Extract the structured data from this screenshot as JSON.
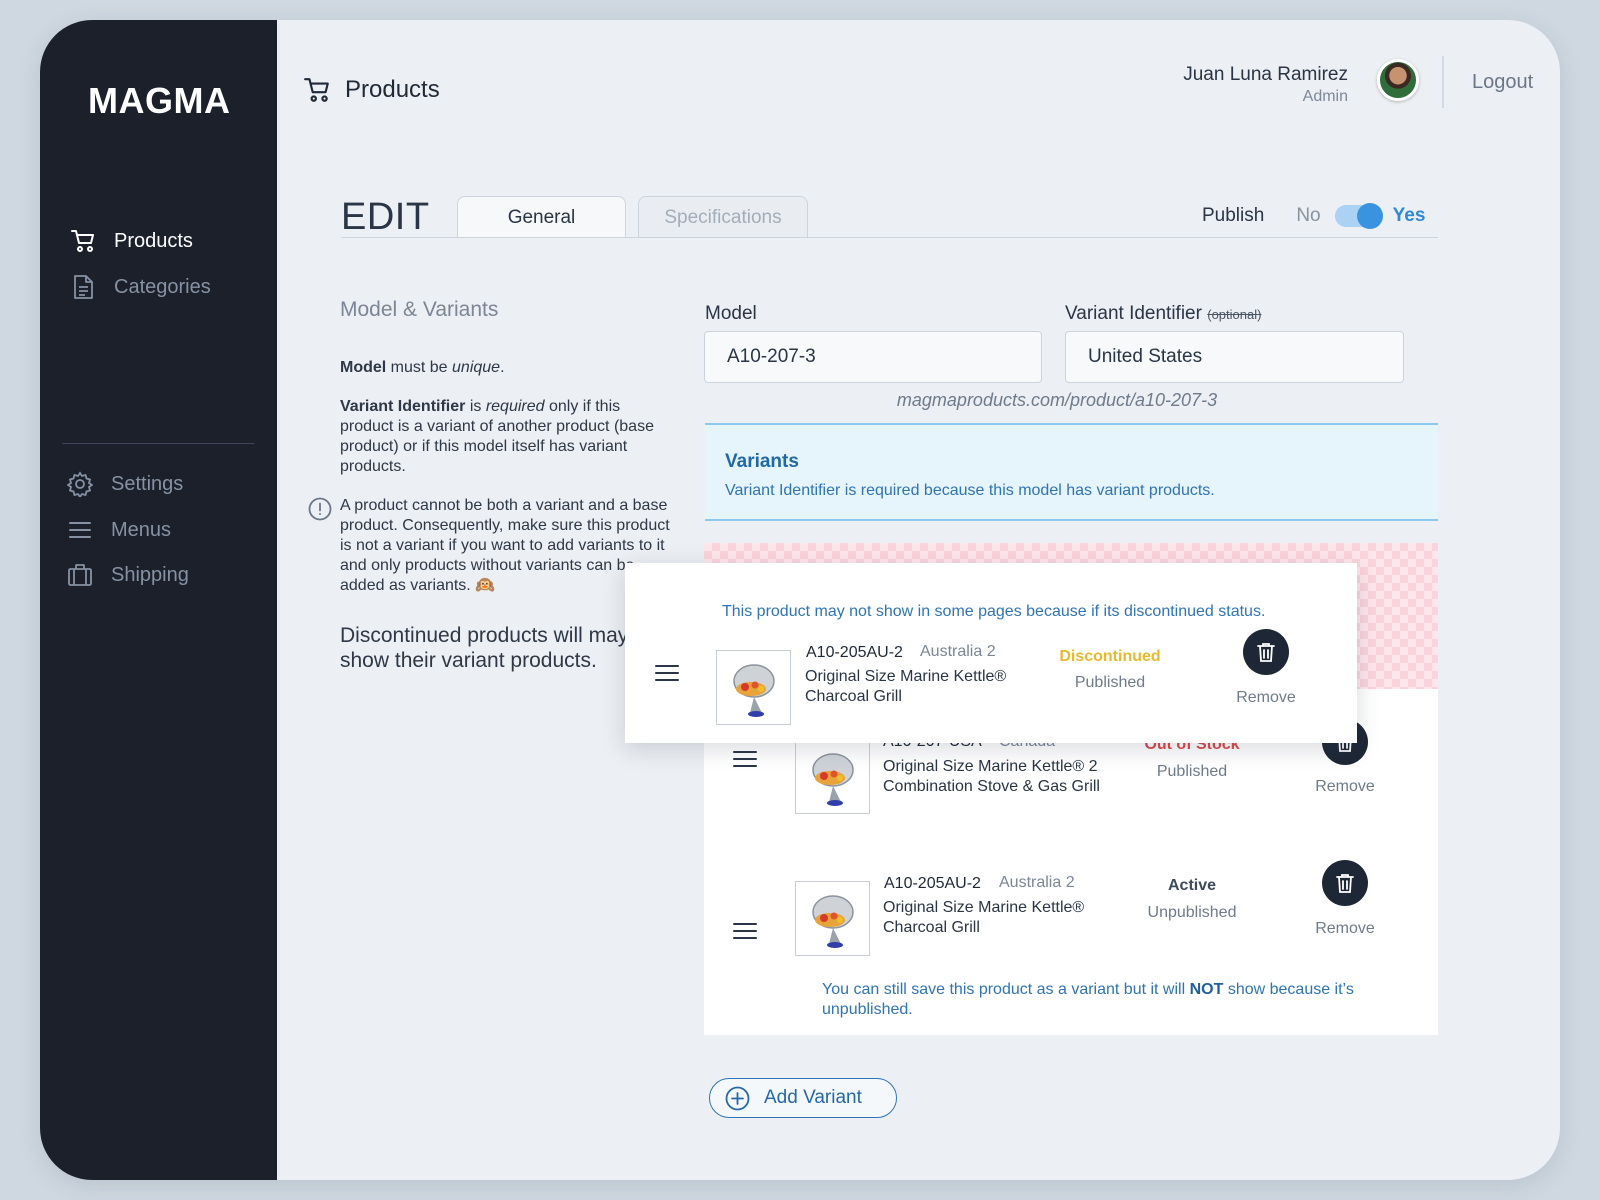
{
  "app": {
    "brand": "MAGMA",
    "page_title": "Products"
  },
  "sidebar": {
    "primary": [
      {
        "label": "Products",
        "icon": "cart-icon",
        "active": true
      },
      {
        "label": "Categories",
        "icon": "document-icon",
        "active": false
      }
    ],
    "secondary": [
      {
        "label": "Settings",
        "icon": "gear-icon"
      },
      {
        "label": "Menus",
        "icon": "menu-icon"
      },
      {
        "label": "Shipping",
        "icon": "briefcase-icon"
      }
    ]
  },
  "user": {
    "name": "Juan Luna Ramirez",
    "role": "Admin",
    "logout_label": "Logout"
  },
  "editor": {
    "title": "EDIT",
    "tabs": [
      {
        "label": "General",
        "active": true
      },
      {
        "label": "Specifications",
        "active": false
      }
    ],
    "publish": {
      "label": "Publish",
      "no_label": "No",
      "yes_label": "Yes",
      "value": true
    }
  },
  "help": {
    "section_title": "Model & Variants",
    "model_rule": {
      "bold": "Model",
      "mid": " must be ",
      "italic": "unique",
      "end": "."
    },
    "variant_rule": {
      "bold": "Variant Identifier",
      "mid": " is ",
      "italic": "required",
      "end": " only if this product is a variant of another product (base product) or if this model itself has variant products."
    },
    "warning": "A product cannot be both a variant and a base product. Consequently, make sure this product is not a variant if you want to add variants to it and only products without variants can be added as variants. 🙉",
    "discontinued_note_line1": "Discontinued products will may",
    "discontinued_note_line2": "show their variant products."
  },
  "form": {
    "model_label": "Model",
    "model_value": "A10-207-3",
    "variant_label": "Variant Identifier",
    "variant_optional": "(optional)",
    "variant_value": "United States",
    "url": "magmaproducts.com/product/a10-207-3"
  },
  "variants_info": {
    "title": "Variants",
    "message": "Variant Identifier is required because this model has variant products."
  },
  "floating_row": {
    "warning": "This product may not show in some pages because if its discontinued status.",
    "sku": "A10-205AU-2",
    "variant": "Australia 2",
    "name_line1": "Original Size Marine Kettle®",
    "name_line2": "Charcoal Grill",
    "status": "Discontinued",
    "status_color": "#e8b92c",
    "published": "Published",
    "remove_label": "Remove"
  },
  "variant_rows": [
    {
      "sku": "A10-207-USA",
      "variant": "Canada",
      "name_line1": "Original Size Marine Kettle® 2",
      "name_line2": "Combination Stove & Gas Grill",
      "status": "Out of Stock",
      "status_color": "#e0474c",
      "published": "Published",
      "remove_label": "Remove"
    },
    {
      "sku": "A10-205AU-2",
      "variant": "Australia 2",
      "name_line1": "Original Size Marine Kettle®",
      "name_line2": "Charcoal Grill",
      "status": "Active",
      "status_color": "#3c4a5c",
      "published": "Unpublished",
      "remove_label": "Remove"
    }
  ],
  "unpublished_msg": {
    "before": "You can still save this product as a variant but it will ",
    "bold": "NOT",
    "after": " show because it’s unpublished."
  },
  "add_variant_label": "Add Variant"
}
